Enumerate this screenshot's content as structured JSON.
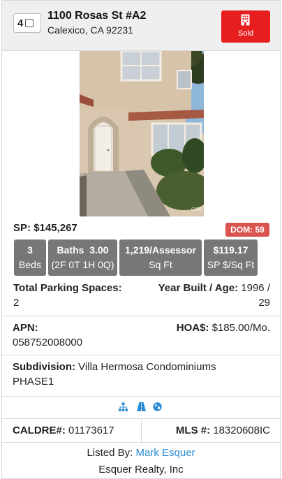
{
  "header": {
    "checkbox_number": "4",
    "address_line1": "1100 Rosas St #A2",
    "address_line2": "Calexico, CA 92231",
    "status_button_label": "Sold",
    "status_color": "#e61e1e"
  },
  "photo": {
    "watermark": "CDB"
  },
  "price": {
    "sold_price_label": "SP:",
    "sold_price_value": "$145,267",
    "dom_label": "DOM: 59"
  },
  "stats": [
    {
      "top": "3",
      "bottom": "Beds"
    },
    {
      "top": "Baths  3.00",
      "bottom": "(2F 0T 1H 0Q)"
    },
    {
      "top": "1,219/Assessor",
      "bottom": "Sq Ft"
    },
    {
      "top": "$119.17",
      "bottom": "SP $/Sq Ft"
    }
  ],
  "details": {
    "parking_label": "Total Parking Spaces:",
    "parking_value": "2",
    "year_built_label": "Year Built / Age:",
    "year_built_value": "1996 /",
    "age_value": "29",
    "apn_label": "APN:",
    "apn_value": "058752008000",
    "hoa_label": "HOA$:",
    "hoa_value": "$185.00/Mo.",
    "subdivision_label": "Subdivision:",
    "subdivision_value": "Villa Hermosa Condominiums",
    "subdivision_value2": "PHASE1"
  },
  "links": {
    "icons": [
      "sitemap-icon",
      "road-icon",
      "globe-icon"
    ],
    "icon_color": "#2a8bd3"
  },
  "licenses": {
    "caldre_label": "CALDRE#:",
    "caldre_value": "01173617",
    "mls_label": "MLS #:",
    "mls_value": "18320608IC"
  },
  "listing": {
    "listed_by_label": "Listed By:",
    "agent_name": "Mark Esquer",
    "brokerage": "Esquer Realty, Inc"
  }
}
